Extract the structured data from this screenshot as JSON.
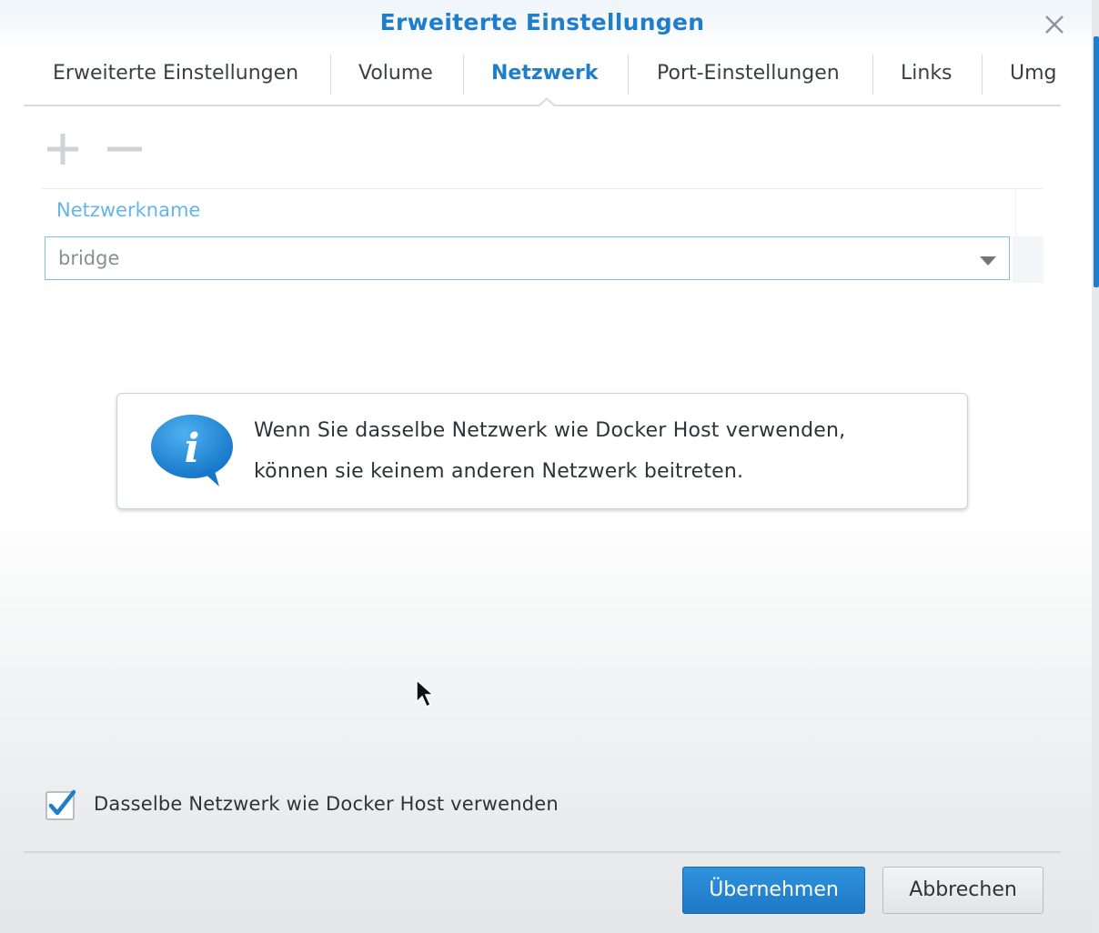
{
  "dialog": {
    "title": "Erweiterte Einstellungen"
  },
  "tabs": [
    {
      "label": "Erweiterte Einstellungen",
      "active": false
    },
    {
      "label": "Volume",
      "active": false
    },
    {
      "label": "Netzwerk",
      "active": true
    },
    {
      "label": "Port-Einstellungen",
      "active": false
    },
    {
      "label": "Links",
      "active": false
    },
    {
      "label": "Umg",
      "active": false
    }
  ],
  "toolbar": {
    "add_icon": "plus-icon",
    "remove_icon": "minus-icon"
  },
  "network_table": {
    "column_header": "Netzwerkname",
    "selected_network": "bridge"
  },
  "info_box": {
    "icon": "info-speech-bubble-icon",
    "line_1": "Wenn Sie dasselbe Netzwerk wie Docker Host verwenden,",
    "line_2": "können sie keinem anderen Netzwerk beitreten."
  },
  "host_network": {
    "label": "Dasselbe Netzwerk wie Docker Host verwenden",
    "checked": true
  },
  "footer": {
    "apply_label": "Übernehmen",
    "cancel_label": "Abbrechen"
  },
  "colors": {
    "accent": "#1f7ecb",
    "header_text": "#64b5e8",
    "select_border": "#7cc0ea"
  }
}
